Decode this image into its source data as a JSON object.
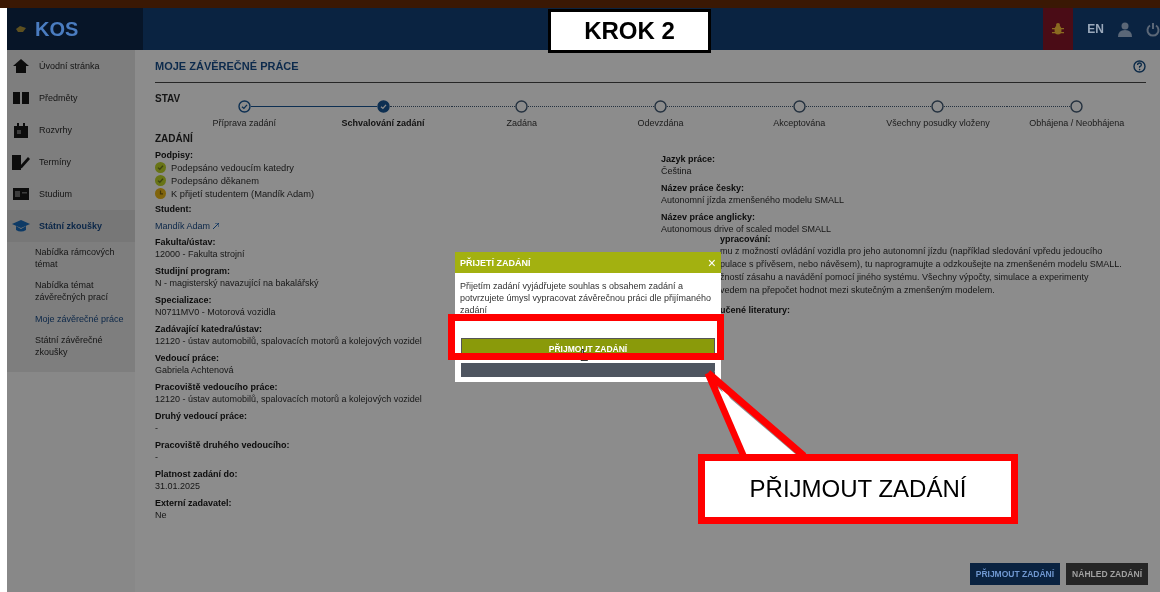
{
  "header": {
    "logo": "KOS",
    "lang": "EN"
  },
  "sidebar": {
    "items": [
      {
        "label": "Úvodní stránka",
        "selected": false
      },
      {
        "label": "Předměty",
        "selected": false
      },
      {
        "label": "Rozvrhy",
        "selected": false
      },
      {
        "label": "Termíny",
        "selected": false
      },
      {
        "label": "Studium",
        "selected": false
      },
      {
        "label": "Státní zkoušky",
        "selected": true,
        "children": [
          {
            "label": "Nabídka rámcových témat",
            "selected": false
          },
          {
            "label": "Nabídka témat závěrečných prací",
            "selected": false
          },
          {
            "label": "Moje závěrečné práce",
            "selected": true
          },
          {
            "label": "Státní závěrečné zkoušky",
            "selected": false
          }
        ]
      }
    ]
  },
  "page": {
    "title": "MOJE ZÁVĚREČNÉ PRÁCE",
    "status_label": "STAV",
    "steps": [
      {
        "label": "Příprava zadání",
        "checked": true,
        "selected": false
      },
      {
        "label": "Schvalování zadání",
        "checked": true,
        "selected": true
      },
      {
        "label": "Zadána",
        "checked": false,
        "selected": false
      },
      {
        "label": "Odevzdána",
        "checked": false,
        "selected": false
      },
      {
        "label": "Akceptována",
        "checked": false,
        "selected": false
      },
      {
        "label": "Všechny posudky vloženy",
        "checked": false,
        "selected": false
      },
      {
        "label": "Obhájena / Neobhájena",
        "checked": false,
        "selected": false
      }
    ],
    "section": "ZADÁNÍ",
    "signatures_label": "Podpisy:",
    "signatures": [
      {
        "text": "Podepsáno vedoucím katedry",
        "kind": "signed"
      },
      {
        "text": "Podepsáno děkanem",
        "kind": "signed"
      },
      {
        "text": "K přijetí studentem (Mandík Adam)",
        "kind": "waiting"
      }
    ],
    "left_fields": [
      {
        "label": "Student:",
        "value": "Mandík Adam",
        "kind": "link"
      },
      {
        "label": "Fakulta/ústav:",
        "value": "12000 - Fakulta strojní",
        "kind": "text"
      },
      {
        "label": "Studijní program:",
        "value": "N - magisterský navazující na bakalářský",
        "kind": "text"
      },
      {
        "label": "Specializace:",
        "value": "N0711MV0 - Motorová vozidla",
        "kind": "text"
      },
      {
        "label": "Zadávající katedra/ústav:",
        "value": "12120 - ústav automobilů, spalovacích motorů a kolejových vozidel",
        "kind": "text"
      },
      {
        "label": "Vedoucí práce:",
        "value": "Gabriela Achtenová",
        "kind": "text"
      },
      {
        "label": "Pracoviště vedoucího práce:",
        "value": "12120 - ústav automobilů, spalovacích motorů a kolejových vozidel",
        "kind": "text"
      },
      {
        "label": "Druhý vedoucí práce:",
        "value": "-",
        "kind": "text"
      },
      {
        "label": "Pracoviště druhého vedoucího:",
        "value": "-",
        "kind": "text"
      },
      {
        "label": "Platnost zadání do:",
        "value": "31.01.2025",
        "kind": "text"
      },
      {
        "label": "Externí zadavatel:",
        "value": "Ne",
        "kind": "text"
      }
    ],
    "right_fields": [
      {
        "label": "Jazyk práce:",
        "value": "Čeština"
      },
      {
        "label": "Název práce česky:",
        "value": "Autonomní jízda zmenšeného modelu SMALL"
      },
      {
        "label": "Název práce anglicky:",
        "value": "Autonomous drive of scaled model SMALL"
      }
    ],
    "partial_label": "ypracování:",
    "partial_lines": [
      "mu z možností ovládání vozidla pro jeho autonomní jízdu (například sledování vpředu jedoucího",
      "pulace s přívěsem, nebo návěsem), tu naprogramujte a odzkoušejte na zmenšeném modelu SMALL.",
      "žností zásahu a navádění pomocí jiného systému. Všechny výpočty, simulace a experimenty",
      "vedem na přepočet hodnot mezi skutečným a zmenšeným modelem."
    ],
    "partial_label_2": "učené literatury:",
    "buttons": [
      {
        "label": "PŘIJMOUT ZADÁNÍ",
        "kind": "primary"
      },
      {
        "label": "NÁHLED ZADÁNÍ",
        "kind": "secondary"
      }
    ]
  },
  "dialog": {
    "title": "PŘIJETÍ ZADÁNÍ",
    "close": "×",
    "message": "Přijetím zadání vyjádřujete souhlas s obsahem zadání a potvrzujete úmysl vypracovat závěrečnou práci dle přijímaného zadání",
    "confirm": "PŘIJMOUT ZADÁNÍ"
  },
  "annotations": {
    "step": "KROK 2",
    "callout": "PŘIJMOUT ZADÁNÍ"
  }
}
